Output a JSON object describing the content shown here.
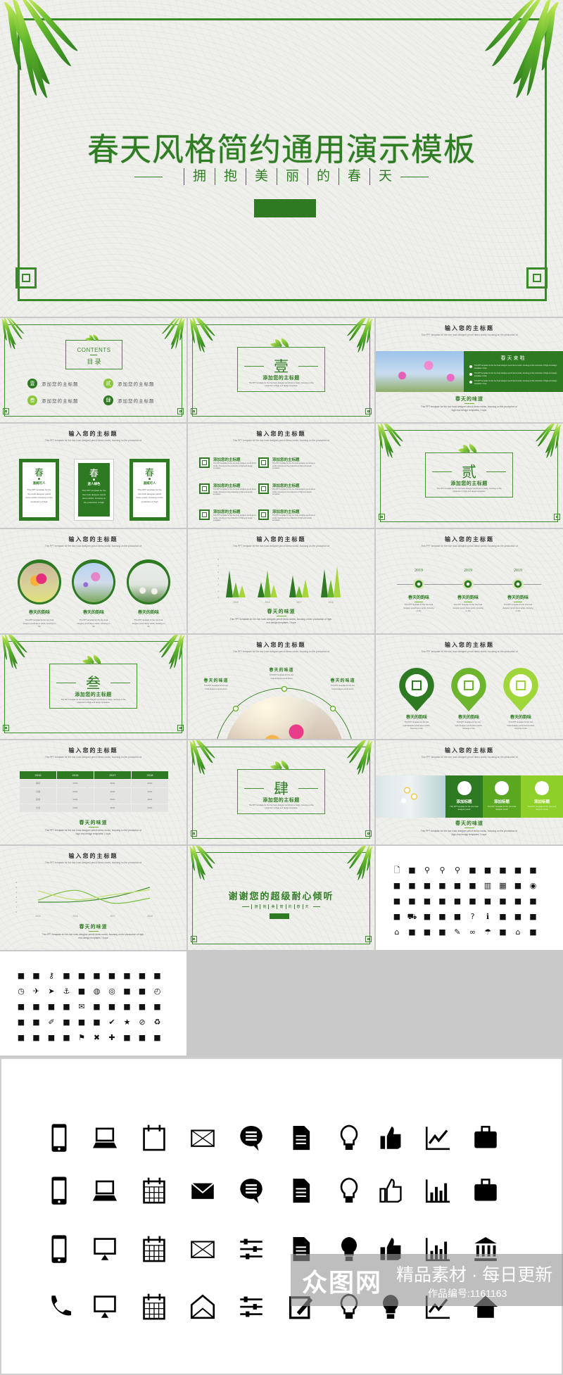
{
  "colors": {
    "dark_green": "#2e7a22",
    "mid_green": "#6cb52d",
    "light_green": "#a6d63a",
    "frame": "#3f8a2e",
    "text": "#333333"
  },
  "main": {
    "title": "春天风格简约通用演示模板",
    "subtitle_chars": [
      "拥",
      "抱",
      "美",
      "丽",
      "的",
      "春",
      "天"
    ]
  },
  "common": {
    "heading": "输入您的主标题",
    "sub": "This PPT template for the rice husk designer pencil demo works, focusing on the production of",
    "caption": "春天的味道",
    "body": "This PPT template for the rice husk designer pencil demo works, focusing on the production of high-end design templates, I hope",
    "short": "This PPT template for the rice husk designer pencil demo works, focusing on the",
    "item_title": "添加您的主标题",
    "item_text": "This PPT template for the rice husk designer pencil demo works, focusing on the production of high-end design templates"
  },
  "contents": {
    "label": "CONTENTS",
    "cn": "目 录",
    "items": [
      {
        "num": "壹",
        "text": "添加您的主标题",
        "color": "#2e7a22"
      },
      {
        "num": "贰",
        "text": "添加您的主标题",
        "color": "#8cc63f"
      },
      {
        "num": "叁",
        "text": "添加您的主标题",
        "color": "#8cc63f"
      },
      {
        "num": "肆",
        "text": "添加您的主标题",
        "color": "#2e7a22"
      }
    ]
  },
  "sections": [
    {
      "num": "壹",
      "title": "添加您的主标题"
    },
    {
      "num": "贰",
      "title": "添加您的主标题"
    },
    {
      "num": "叁",
      "title": "添加您的主标题"
    },
    {
      "num": "肆",
      "title": "添加您的主标题"
    }
  ],
  "banner": {
    "title": "春天来啦",
    "bullets": [
      "This PPT template for the rice husk designer pencil demo works, focusing on the production of high-end design templates I hope",
      "This PPT template for the rice husk designer pencil demo works, focusing on the production of high-end design templates I hope",
      "This PPT template for the rice husk designer pencil demo works, focusing on the production of high-end design templates I hope"
    ]
  },
  "cards": [
    {
      "char": "春",
      "sub": "温婉可人",
      "text": "This PPT template for the rice husk designer pencil demo works. focusing on the production of high"
    },
    {
      "char": "春",
      "sub": "迷人绿色",
      "text": "This PPT template for the rice husk designer pencil demo works. focusing on the production of high"
    },
    {
      "char": "春",
      "sub": "温婉可人",
      "text": "This PPT template for the rice husk designer pencil demo works. focusing on the production of high"
    }
  ],
  "circles": {
    "title": "春天的韵味",
    "text": "This PPT template for the rice husk designer pencil demo works, focusing on the"
  },
  "timeline": {
    "years": [
      "2019",
      "2019",
      "2019"
    ],
    "title": "春天的韵味",
    "text": "This PPT template for the rice husk designer pencil demo works, focusing on the"
  },
  "arc": {
    "side_title": "春天的味道",
    "center_title": "春天的味道",
    "text": "This PPT template for the rice husk designer pencil demo"
  },
  "pins": {
    "title": "春天的韵味",
    "text": "This PPT template for the rice husk designer pencil demo works, focusing on the",
    "colors": [
      "#2e7a22",
      "#6cb52d",
      "#9fd63a"
    ],
    "icons": [
      "monitor-icon",
      "burger-icon",
      "column-icon"
    ]
  },
  "table": {
    "headers": [
      "2015",
      "2016",
      "2017",
      "2018"
    ],
    "rows": [
      [
        "库存",
        "0000",
        "8000",
        "9000"
      ],
      [
        "日销",
        "0000",
        "8000",
        "9000"
      ],
      [
        "完成",
        "0000",
        "8000",
        "9000"
      ],
      [
        "计划",
        "0000",
        "8000",
        "9000"
      ]
    ]
  },
  "tiles": {
    "items": [
      {
        "title": "添加标题",
        "text": "This PPT template for the rice husk designer pencil",
        "color": "#2e7a22",
        "icon": "monitor-icon"
      },
      {
        "title": "添加标题",
        "text": "This PPT template for the rice husk designer pencil",
        "color": "#5aa820",
        "icon": "layout-icon"
      },
      {
        "title": "添加标题",
        "text": "This PPT template for the rice husk designer pencil",
        "color": "#8fcf2a",
        "icon": "camera-icon"
      }
    ]
  },
  "thanks": {
    "title": "谢谢您的超级耐心倾听",
    "sub_chars": [
      "拥",
      "抱",
      "美",
      "丽",
      "的",
      "春",
      "天"
    ]
  },
  "chart_data": [
    {
      "type": "bar",
      "categories": [
        "2015",
        "2016",
        "2017",
        "2018"
      ],
      "ylim": [
        0,
        6
      ],
      "yticks": [
        0,
        1,
        2,
        3,
        4,
        5,
        6
      ],
      "series": [
        {
          "values": [
            4.3,
            2.4,
            3.5,
            4.5
          ],
          "color": "#2e7a22"
        },
        {
          "values": [
            2.4,
            4.3,
            1.8,
            2.8
          ],
          "color": "#6cb52d"
        },
        {
          "values": [
            1.9,
            2.0,
            2.9,
            5.0
          ],
          "color": "#a6d63a"
        }
      ],
      "grid": false
    },
    {
      "type": "line",
      "categories": [
        "2015",
        "2016",
        "2017",
        "2018"
      ],
      "ylim": [
        0,
        6
      ],
      "yticks": [
        0,
        1,
        2,
        3,
        4,
        5,
        6
      ],
      "series": [
        {
          "values": [
            2,
            2.1,
            3,
            5
          ],
          "color": "#3f8f2c"
        },
        {
          "values": [
            2.4,
            4.4,
            1.8,
            2.8
          ],
          "color": "#7cc043"
        },
        {
          "values": [
            4.3,
            2.5,
            3.5,
            4.5
          ],
          "color": "#c2e06a"
        }
      ],
      "grid": false
    }
  ],
  "icon_slide_a": [
    "document",
    "book",
    "search",
    "zoom-in",
    "zoom-out",
    "folder-user",
    "file-search",
    "file",
    "file-edit",
    "file-lock",
    "bag",
    "briefcase",
    "medkit",
    "folder",
    "folder-open",
    "folder-dark",
    "columns",
    "grid",
    "save",
    "disc",
    "download",
    "tree",
    "sitemap",
    "rss",
    "arrow-up-bold",
    "arrow-up",
    "comment",
    "thumbs-up",
    "thumbs-down",
    "hand",
    "sale",
    "cart",
    "tag",
    "battery",
    "mug",
    "help",
    "info",
    "cart-full",
    "cart-plus",
    "books",
    "home",
    "bulb",
    "eraser",
    "clip",
    "pen",
    "glasses",
    "umbrella",
    "tower",
    "house",
    "bank"
  ],
  "icon_slide_b": [
    "user",
    "user-x",
    "key",
    "lock",
    "unlock",
    "printer",
    "printer-alt",
    "user-add",
    "users",
    "user-tie",
    "clock",
    "plane",
    "cursor",
    "anchor",
    "award",
    "globe",
    "target",
    "tag",
    "calendar",
    "clock-alt",
    "bag-lock",
    "stopwatch",
    "pound",
    "card",
    "mail",
    "mail-open",
    "mail-open-alt",
    "id-card",
    "bag-1",
    "bag-9",
    "sign",
    "inbox",
    "wrench",
    "tools",
    "pie",
    "bar",
    "check",
    "star",
    "ban",
    "recycle",
    "mouse",
    "phone-old",
    "monitor",
    "plug",
    "flag",
    "cross",
    "plus",
    "mobile",
    "sound",
    "stamp"
  ],
  "icon_panel": [
    [
      "mobile-icon",
      "laptop-icon",
      "calendar-icon",
      "envelope-icon",
      "chat-icon",
      "doc-search-icon",
      "bulb-idea-icon",
      "thumbs-up-icon",
      "trend-chart-icon",
      "suitcase-icon"
    ],
    [
      "devices-icon",
      "laptop-outline-icon",
      "calendar-grid-icon",
      "envelope-filled-icon",
      "chat-double-icon",
      "document-icon",
      "bulb-outline-icon",
      "thumbs-up-outline-icon",
      "bar-chart-icon",
      "briefcase-icon"
    ],
    [
      "tablet-icon",
      "monitor-icon",
      "calendar-dots-icon",
      "envelope-outline-icon",
      "sliders-icon",
      "doc-magnify-icon",
      "bulb-leaf-icon",
      "like-icon",
      "bars-icon",
      "bank-icon"
    ],
    [
      "phone-icon",
      "computer-icon",
      "calendar-spiral-icon",
      "envelope-open-icon",
      "sliders-alt-icon",
      "edit-icon",
      "bulb-filament-icon",
      "cfl-bulb-icon",
      "growth-chart-icon",
      "home-icon"
    ]
  ],
  "watermark": {
    "brand": "众图网",
    "slogan": "精品素材 · 每日更新",
    "id": "作品编号:1161163"
  }
}
